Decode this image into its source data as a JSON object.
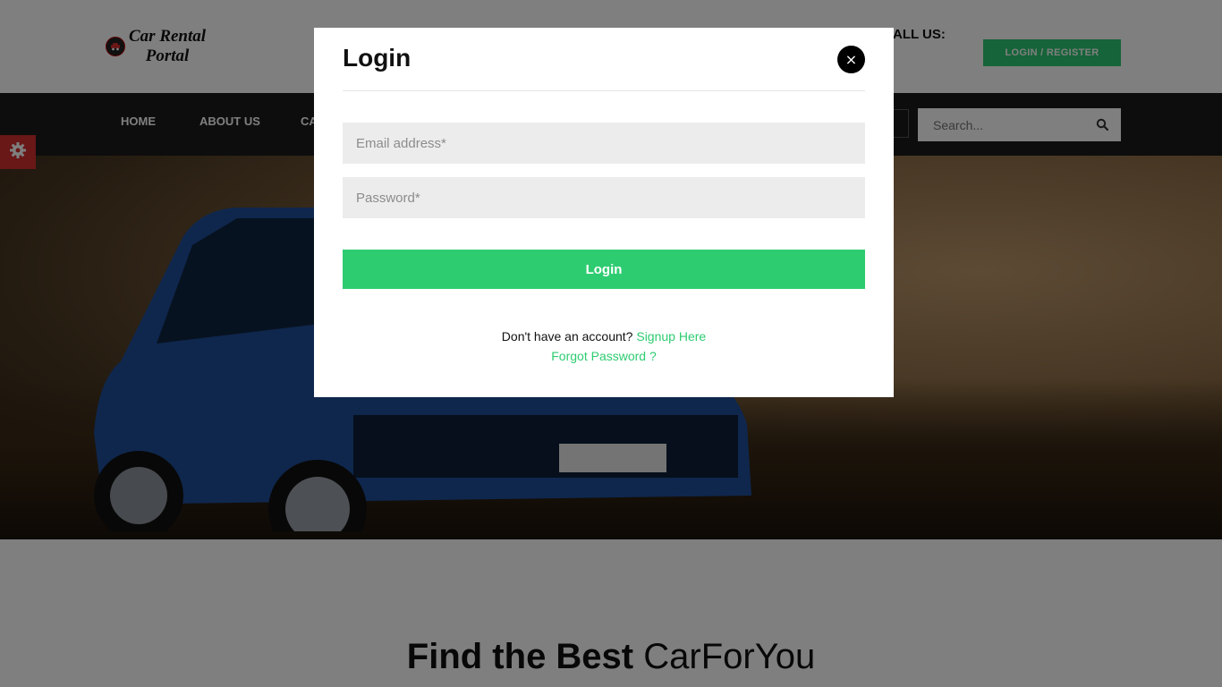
{
  "header": {
    "logo_line1": "Car Rental",
    "logo_line2": "Portal",
    "call_us": "ALL US:",
    "login_register": "LOGIN / REGISTER"
  },
  "nav": {
    "items": [
      "HOME",
      "ABOUT US",
      "CA"
    ]
  },
  "search": {
    "placeholder": "Search..."
  },
  "section": {
    "title_strong": "Find the Best",
    "title_light": "CarForYou"
  },
  "modal": {
    "title": "Login",
    "close": "×",
    "email_placeholder": "Email address*",
    "password_placeholder": "Password*",
    "submit": "Login",
    "no_account": "Don't have an account?",
    "signup": "Signup Here",
    "forgot": "Forgot Password ?"
  },
  "colors": {
    "accent": "#2ecc71",
    "nav_bg": "#1a1a1a",
    "settings_tab": "#d32f2f"
  },
  "icons": {
    "logo": "car-logo-icon",
    "settings": "gear-icon",
    "search": "search-icon"
  }
}
